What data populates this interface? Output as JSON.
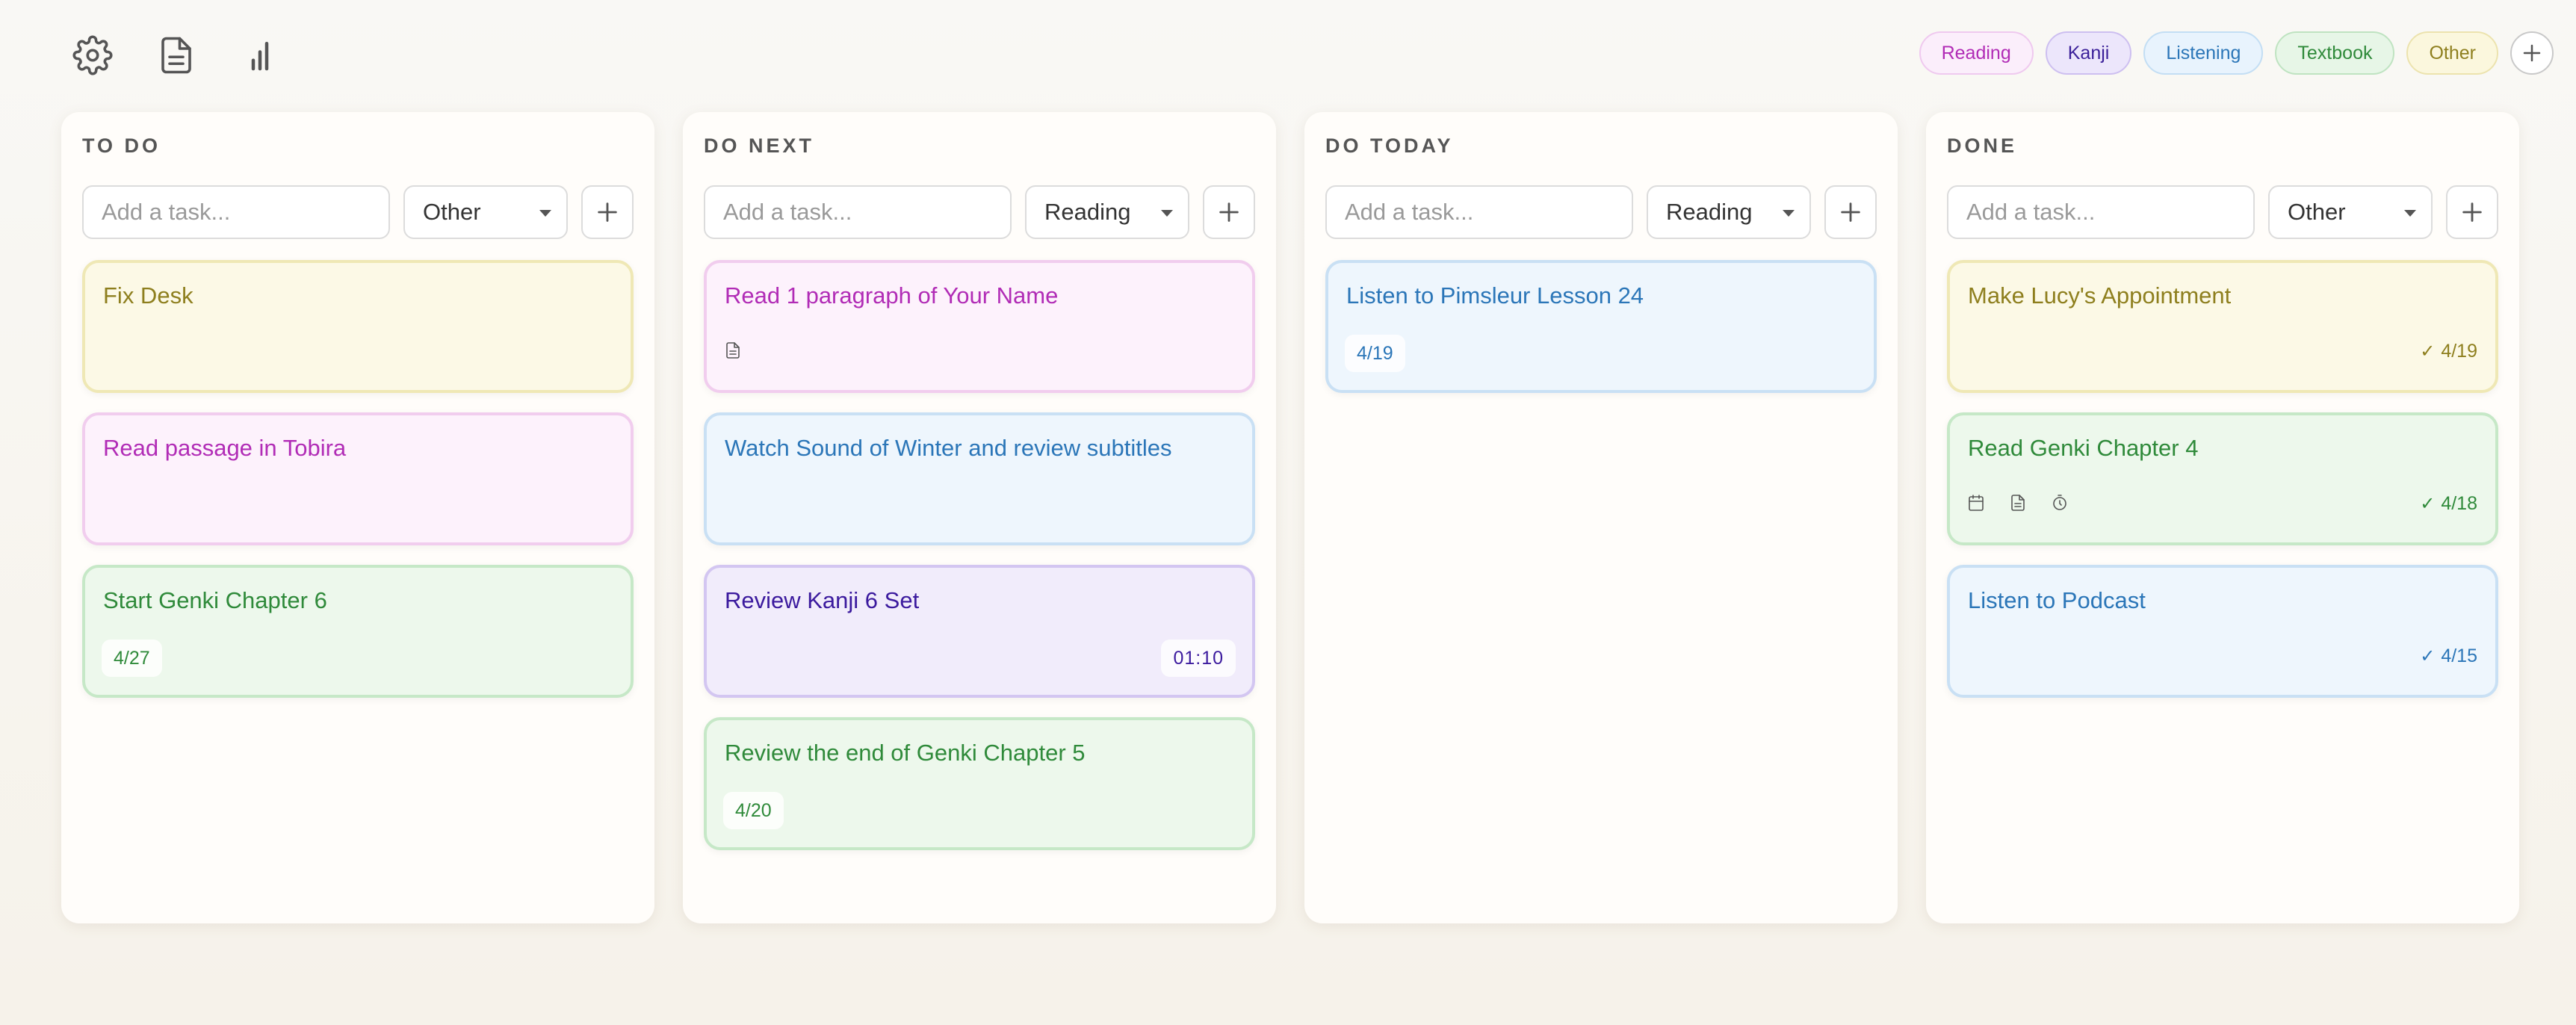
{
  "toolbar": {
    "icons": [
      "gear-icon",
      "document-icon",
      "bar-chart-icon"
    ]
  },
  "tags": [
    {
      "label": "Reading",
      "color": "#b12cb6",
      "bg": "#fbeefb",
      "border": "#efc9ef"
    },
    {
      "label": "Kanji",
      "color": "#3a1f99",
      "bg": "#ece6fb",
      "border": "#cdbff0"
    },
    {
      "label": "Listening",
      "color": "#2b76b8",
      "bg": "#e8f3fd",
      "border": "#c3def4"
    },
    {
      "label": "Textbook",
      "color": "#2f8a3a",
      "bg": "#e7f6e7",
      "border": "#bfe3c1"
    },
    {
      "label": "Other",
      "color": "#8e7f1e",
      "bg": "#fbf7dd",
      "border": "#ece3ae"
    }
  ],
  "columns": [
    {
      "title": "TO DO",
      "placeholder": "Add a task...",
      "category": "Other",
      "cards": [
        {
          "title": "Fix Desk",
          "cat": "Other"
        },
        {
          "title": "Read passage in Tobira",
          "cat": "Reading"
        },
        {
          "title": "Start Genki Chapter 6",
          "cat": "Textbook",
          "date": "4/27"
        }
      ]
    },
    {
      "title": "DO NEXT",
      "placeholder": "Add a task...",
      "category": "Reading",
      "cards": [
        {
          "title": "Read 1 paragraph of Your Name",
          "cat": "Reading",
          "icons": [
            "document-icon"
          ]
        },
        {
          "title": "Watch Sound of Winter and review subtitles",
          "cat": "Listening"
        },
        {
          "title": "Review Kanji 6 Set",
          "cat": "Kanji",
          "timer": "01:10"
        },
        {
          "title": "Review the end of Genki Chapter 5",
          "cat": "Textbook",
          "date": "4/20"
        }
      ]
    },
    {
      "title": "DO TODAY",
      "placeholder": "Add a task...",
      "category": "Reading",
      "cards": [
        {
          "title": "Listen to Pimsleur Lesson 24",
          "cat": "Listening",
          "date": "4/19"
        }
      ]
    },
    {
      "title": "DONE",
      "placeholder": "Add a task...",
      "category": "Other",
      "cards": [
        {
          "title": "Make Lucy's Appointment",
          "cat": "Other",
          "done": "4/19"
        },
        {
          "title": "Read Genki Chapter 4",
          "cat": "Textbook",
          "done": "4/18",
          "icons": [
            "calendar-icon",
            "document-icon",
            "timer-icon"
          ]
        },
        {
          "title": "Listen to Podcast",
          "cat": "Listening",
          "done": "4/15"
        }
      ]
    }
  ],
  "colors": {
    "Reading": {
      "text": "#b12cb6",
      "bg": "#fdf2fc",
      "border": "#f1cdee"
    },
    "Kanji": {
      "text": "#3b1a9e",
      "bg": "#f1ecfb",
      "border": "#d3c6f1"
    },
    "Listening": {
      "text": "#2b76b8",
      "bg": "#eef6fd",
      "border": "#c9e0f4"
    },
    "Textbook": {
      "text": "#2f8a3a",
      "bg": "#edf8ec",
      "border": "#c6e8c7"
    },
    "Other": {
      "text": "#8e7f1e",
      "bg": "#fcf9e6",
      "border": "#efe8b5"
    }
  }
}
